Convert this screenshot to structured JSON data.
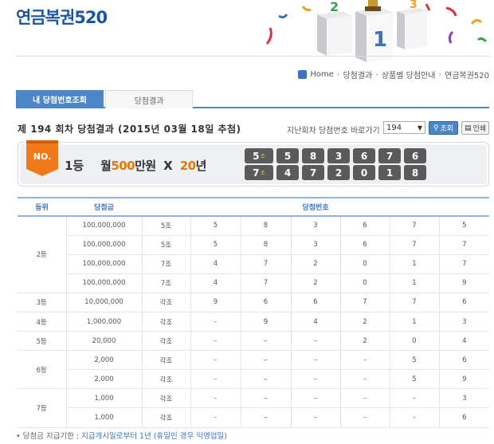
{
  "header": {
    "title": "연금복권520"
  },
  "breadcrumb": [
    "Home",
    "당첨결과",
    "상품별 당첨안내",
    "연금복권520"
  ],
  "tabs": [
    {
      "label": "내 당첨번호조회",
      "active": true
    },
    {
      "label": "당첨결과",
      "active": false
    }
  ],
  "draw": {
    "title": "제 194 회차 당첨결과 (2015년 03월 18일 추첨)",
    "goto_label": "지난회차 당첨번호 바로가기",
    "selected_round": "194",
    "search_label": "조회",
    "print_label": "인쇄"
  },
  "prize": {
    "badge": "NO.",
    "rank": "1등",
    "amount_prefix": "월",
    "amount_highlight": "500",
    "amount_suffix": "만원  X  ",
    "years_highlight": "20",
    "years_suffix": "년",
    "group_suffix": "조",
    "rows": [
      {
        "group": "5",
        "numbers": [
          "5",
          "8",
          "3",
          "6",
          "7",
          "6"
        ]
      },
      {
        "group": "7",
        "numbers": [
          "4",
          "7",
          "2",
          "0",
          "1",
          "8"
        ]
      }
    ]
  },
  "table": {
    "headers": {
      "rank": "등위",
      "amount": "당첨금",
      "numbers": "당첨번호"
    },
    "groups": [
      {
        "rank": "2등",
        "rows": [
          {
            "amount": "100,000,000",
            "group": "5조",
            "digits": [
              "5",
              "8",
              "3",
              "6",
              "7",
              "5"
            ]
          },
          {
            "amount": "100,000,000",
            "group": "5조",
            "digits": [
              "5",
              "8",
              "3",
              "6",
              "7",
              "7"
            ]
          },
          {
            "amount": "100,000,000",
            "group": "7조",
            "digits": [
              "4",
              "7",
              "2",
              "0",
              "1",
              "7"
            ]
          },
          {
            "amount": "100,000,000",
            "group": "7조",
            "digits": [
              "4",
              "7",
              "2",
              "0",
              "1",
              "9"
            ]
          }
        ]
      },
      {
        "rank": "3등",
        "rows": [
          {
            "amount": "10,000,000",
            "group": "각조",
            "digits": [
              "9",
              "6",
              "6",
              "7",
              "7",
              "6"
            ]
          }
        ]
      },
      {
        "rank": "4등",
        "rows": [
          {
            "amount": "1,000,000",
            "group": "각조",
            "digits": [
              "–",
              "9",
              "4",
              "2",
              "1",
              "3"
            ]
          }
        ]
      },
      {
        "rank": "5등",
        "rows": [
          {
            "amount": "20,000",
            "group": "각조",
            "digits": [
              "–",
              "–",
              "–",
              "2",
              "0",
              "4"
            ]
          }
        ]
      },
      {
        "rank": "6등",
        "rows": [
          {
            "amount": "2,000",
            "group": "각조",
            "digits": [
              "–",
              "–",
              "–",
              "–",
              "5",
              "6"
            ]
          },
          {
            "amount": "2,000",
            "group": "각조",
            "digits": [
              "–",
              "–",
              "–",
              "–",
              "5",
              "9"
            ]
          }
        ]
      },
      {
        "rank": "7등",
        "rows": [
          {
            "amount": "1,000",
            "group": "각조",
            "digits": [
              "–",
              "–",
              "–",
              "–",
              "–",
              "3"
            ]
          },
          {
            "amount": "1,000",
            "group": "각조",
            "digits": [
              "–",
              "–",
              "–",
              "–",
              "–",
              "6"
            ]
          }
        ]
      }
    ]
  },
  "footnote": {
    "prefix": "• 당첨금 지급기한 : ",
    "text": "지급개시일로부터 1년 (휴일인 경우 익영업일)"
  },
  "colors": {
    "brand_blue": "#1d55a0",
    "tab_blue": "#4a86c8",
    "highlight_orange": "#e07a10",
    "ball_gray": "#5a5a5a"
  }
}
